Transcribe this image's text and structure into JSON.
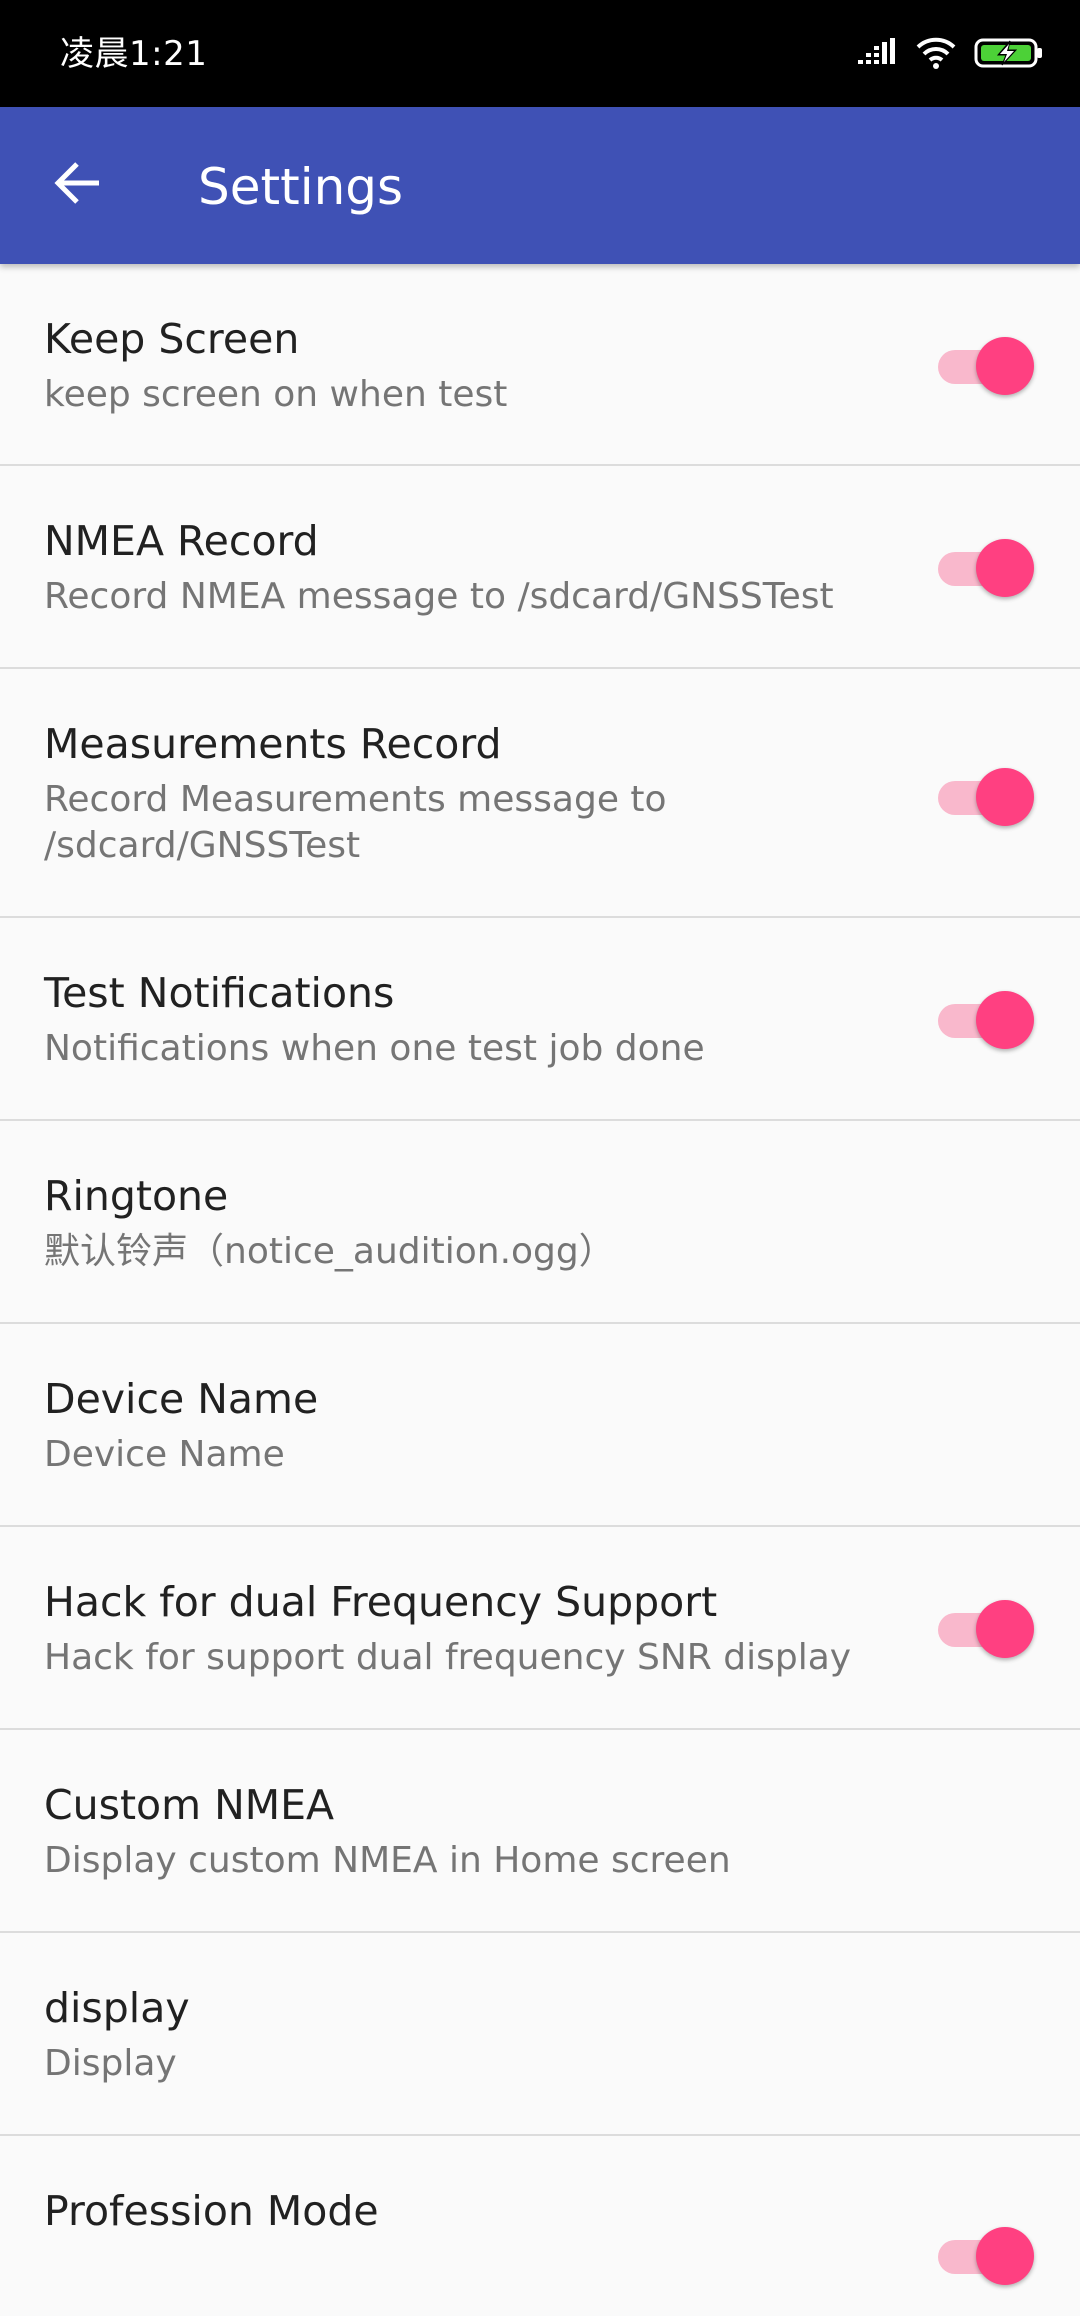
{
  "status_bar": {
    "time": "凌晨1:21",
    "icons": [
      "signal-icon",
      "wifi-icon",
      "battery-charging-icon"
    ],
    "battery_color": "#4cd137"
  },
  "app_bar": {
    "title": "Settings",
    "back_icon": "arrow-back-icon",
    "background_color": "#3f51b5"
  },
  "accent_color": "#ff4081",
  "preferences": [
    {
      "title": "Keep Screen",
      "summary": "keep screen on when test",
      "switch": true,
      "checked": true
    },
    {
      "title": "NMEA Record",
      "summary": "Record NMEA message to /sdcard/GNSSTest",
      "switch": true,
      "checked": true
    },
    {
      "title": "Measurements Record",
      "summary": "Record Measurements message to /sdcard/GNSSTest",
      "switch": true,
      "checked": true
    },
    {
      "title": "Test Notifications",
      "summary": "Notifications when one test job done",
      "switch": true,
      "checked": true
    },
    {
      "title": "Ringtone",
      "summary": "默认铃声（notice_audition.ogg）",
      "switch": false
    },
    {
      "title": "Device Name",
      "summary": "Device Name",
      "switch": false
    },
    {
      "title": "Hack for dual Frequency Support",
      "summary": "Hack for support dual frequency SNR display",
      "switch": true,
      "checked": true
    },
    {
      "title": "Custom NMEA",
      "summary": "Display custom NMEA in Home screen",
      "switch": false
    },
    {
      "title": "display",
      "summary": "Display",
      "switch": false
    },
    {
      "title": "Profession Mode",
      "summary": "",
      "switch": true,
      "checked": true
    }
  ]
}
